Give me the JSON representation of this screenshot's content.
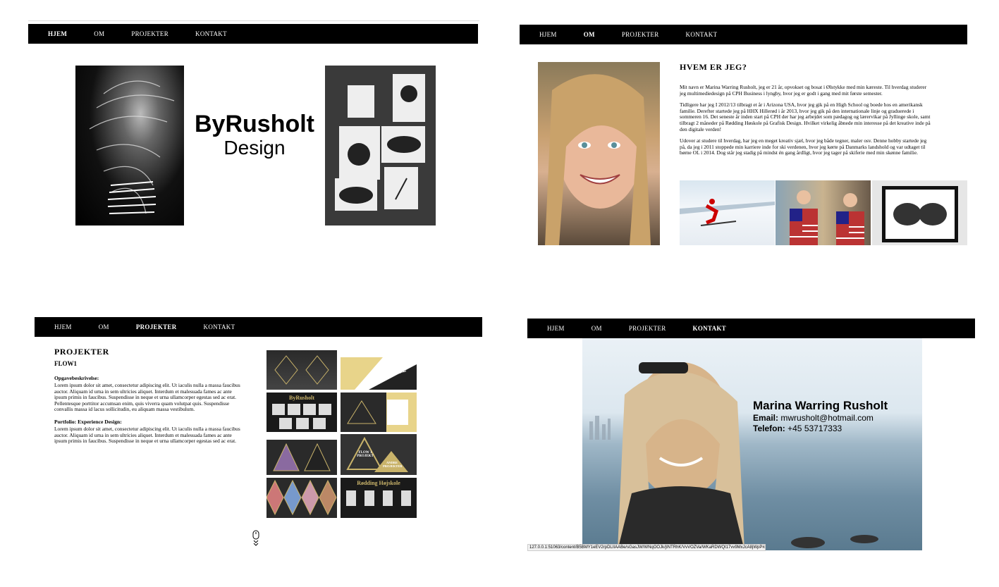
{
  "nav": {
    "items": [
      "HJEM",
      "OM",
      "PROJEKTER",
      "KONTAKT"
    ]
  },
  "home": {
    "brand_line1": "ByRusholt",
    "brand_line2": "Design"
  },
  "about": {
    "heading": "HVEM ER JEG?",
    "paragraphs": [
      "Mit navn er Marina Warring Rusholt, jeg er 21 år, opvokset og bosat i Ølstykke med min kæreste. Til hverdag studerer jeg multimediedesign på CPH Business i lyngby, hvor jeg er godt i gang med mit første semester.",
      "Tidligere har jeg I 2012/13 tilbragt et år i Arizona USA, hvor jeg gik på en High School og boede hos en amerikansk familie. Derefter startede jeg på HHX Hillerød i år 2013, hvor jeg gik på den internationale linje og graduerede i sommeren 16. Det seneste år inden start på CPH der har jeg arbejdet som pædagog og lærervikar på Jyllinge skole, samt tilbragt 2 måneder på Rødding Høskole på Grafisk Design. Hvilket virkelig åbnede min interesse på det kreative inde på den digitale verden!",
      "Udover at studere til hverdag, har jeg en meget kreativ sjæl, hvor jeg både tegner, maler osv. Denne hobby startede jeg på, da jeg i 2011 stoppede min karriere inde for ski verdenen, hvor jeg kørte på Danmarks landshold og var udtaget til børne OL i 2014. Dog står jeg stadig på mindst én gang årdligt, hvor jeg tager på skiferie med min skønne familie."
    ]
  },
  "projects": {
    "heading": "PROJEKTER",
    "subheading": "FLOW1",
    "section1_title": "Opgavebeskrivelse:",
    "section1_text": "Lorem ipsum dolor sit amet, consectetur adipiscing elit. Ut iaculis nulla a massa faucibus auctor. Aliquam id urna in sem ultricies aliquet. Interdum et malesuada fames ac ante ipsum primis in faucibus. Suspendisse in neque et urna ullamcorper egestas sed ac erat. Pellentesque porttitor accumsan enim, quis viverra quam volutpat quis. Suspendisse convallis massa id lacus sollicitudin, eu aliquam massa vestibulum.",
    "section2_title": "Portfolio: Experience Design:",
    "section2_text": "Lorem ipsum dolor sit amet, consectetur adipiscing elit. Ut iaculis nulla a massa faucibus auctor. Aliquam id urna in sem ultricies aliquet. Interdum et malesuada fames ac ante ipsum primis in faucibus. Suspendisse in neque et urna ullamcorper egestas sed ac erat.",
    "thumb_byrusholt": "ByRusholt",
    "thumb_portfolio": "PORTFOLIE",
    "thumb_flow": "FLOW 1 PROJEKT",
    "thumb_andre": "ANDRE PROJEKTER",
    "thumb_rodding": "Rødding Højskole",
    "scroll_icon": "mouse-scroll-icon"
  },
  "contact": {
    "name": "Marina Warring Rusholt",
    "email_label": "Email:",
    "email": "mwrusholt@hotmail.com",
    "phone_label": "Telefon:",
    "phone": "+45 53717333",
    "status_url": "127.0.0.1:51063/content/B5BMY1eEV2rpDLIIAABe/sGasJW/WNqOOJk/jINTRhK/VvVOZVa/WKaRDWQI17vv9MxJcA8jWpP#/jem"
  },
  "colors": {
    "nav_bg": "#000000",
    "nav_text": "#ffffff",
    "page_bg": "#ffffff",
    "gold": "#c9b36a"
  }
}
